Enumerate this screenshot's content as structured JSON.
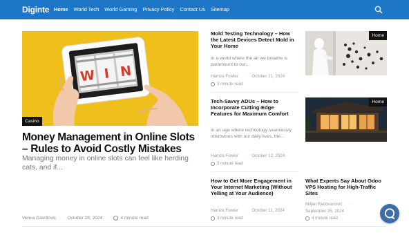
{
  "header": {
    "logo": "Diginte",
    "nav": [
      "Home",
      "World Tech",
      "World Gaming",
      "Privacy Policy",
      "Contact Us",
      "Sitemap"
    ]
  },
  "hero": {
    "category": "Casino",
    "slot_text": "WIN",
    "title": "Money Management in Online Slots – Rules to Avoid Costly Mistakes",
    "excerpt": "Managing money in online slots can feel like herding cats, and if...",
    "author": "Verica Gavrilovic",
    "date": "October 28, 2024",
    "read_time": "4 minute read"
  },
  "middle": [
    {
      "title": "Mold Testing Technology – How the Latest Devices Detect Mold in Your Home",
      "excerpt": "In a world where the air we breathe is paramount to our...",
      "author": "Hamza Fowler",
      "date": "October 21, 2024",
      "read_time": "3 minute read"
    },
    {
      "title": "Tech-Savvy ADUs – How to Incorporate Cutting-Edge Features for Maximum Comfort",
      "excerpt": "In an age where technology seamlessly intertwines with our daily lives, the...",
      "author": "Hamza Fowler",
      "date": "October 12, 2024",
      "read_time": "3 minute read"
    },
    {
      "title": "How to Get More Engagement in Your Internet Marketing (Without Yelling at Your Audience)",
      "author": "Hamza Fowler",
      "date": "October 11, 2024",
      "read_time": "3 minute read"
    }
  ],
  "right": [
    {
      "badge": "Home"
    },
    {
      "badge": "Home"
    },
    {
      "title": "What Experts Say About Odoo VPS Hosting for High-Traffic Sites",
      "author": "Miljan Radovanovic",
      "date": "September 25, 2024",
      "read_time": "4 minute read"
    }
  ],
  "colors": {
    "header_bg": "#1e76c7",
    "hero_bg": "#efbf1c",
    "badge_bg": "#111111",
    "chat_bg": "#3c6fa6"
  },
  "icons": {
    "search": "search-icon",
    "read_time": "clock-icon",
    "chat": "chat-bubble-icon"
  }
}
